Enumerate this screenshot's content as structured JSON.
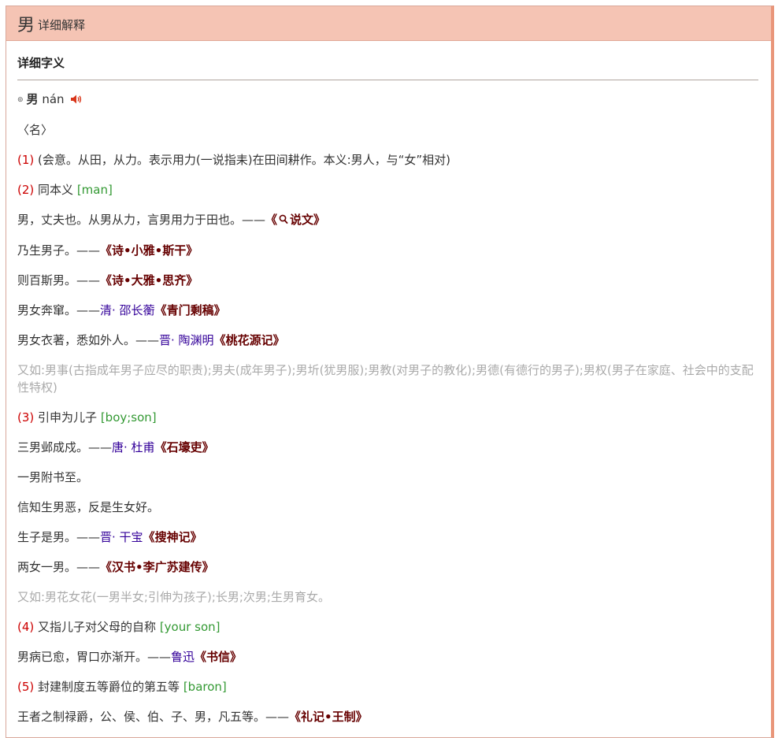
{
  "header": {
    "char": "男",
    "subtitle": "详细解释"
  },
  "section": {
    "title": "详细字义"
  },
  "pronunciation": {
    "char": "男",
    "pinyin": "nán"
  },
  "pos": "〈名〉",
  "entries": [
    {
      "type": "def",
      "num": "(1)",
      "text": "(会意。从田，从力。表示用力(一说指耒)在田间耕作。本义:男人，与“女”相对)",
      "en": ""
    },
    {
      "type": "def",
      "num": "(2)",
      "text": "同本义",
      "en": "[man]"
    },
    {
      "type": "ex",
      "text": "男，丈夫也。从男从力，言男用力于田也。——",
      "author": "",
      "source_open": "《",
      "source": "说文",
      "source_close": "》",
      "search_icon": true
    },
    {
      "type": "ex",
      "text": "乃生男子。——",
      "author": "",
      "source": "《诗•小雅•斯干》"
    },
    {
      "type": "ex",
      "text": "则百斯男。——",
      "author": "",
      "source": "《诗•大雅•思齐》"
    },
    {
      "type": "ex",
      "text": "男女奔窜。——",
      "author": "清· 邵长蘅",
      "source": "《青门剩稿》"
    },
    {
      "type": "ex",
      "text": "男女衣著，悉如外人。——",
      "author": "晋· 陶渊明",
      "source": "《桃花源记》"
    },
    {
      "type": "note",
      "text": "又如:男事(古指成年男子应尽的职责);男夫(成年男子);男圻(犹男服);男教(对男子的教化);男德(有德行的男子);男权(男子在家庭、社会中的支配性特权)"
    },
    {
      "type": "def",
      "num": "(3)",
      "text": "引申为儿子",
      "en": "[boy;son]"
    },
    {
      "type": "ex",
      "text": "三男邺成戍。——",
      "author": "唐· 杜甫",
      "source": "《石壕吏》"
    },
    {
      "type": "ex",
      "text": "一男附书至。",
      "author": "",
      "source": ""
    },
    {
      "type": "ex",
      "text": "信知生男恶，反是生女好。",
      "author": "",
      "source": ""
    },
    {
      "type": "ex",
      "text": "生子是男。——",
      "author": "晋· 干宝",
      "source": "《搜神记》"
    },
    {
      "type": "ex",
      "text": "两女一男。——",
      "author": "",
      "source": "《汉书•李广苏建传》"
    },
    {
      "type": "note",
      "text": "又如:男花女花(一男半女;引伸为孩子);长男;次男;生男育女。"
    },
    {
      "type": "def",
      "num": "(4)",
      "text": "又指儿子对父母的自称",
      "en": "[your son]"
    },
    {
      "type": "ex",
      "text": "男病已愈，胃口亦渐开。——",
      "author": "鲁迅",
      "source": "《书信》"
    },
    {
      "type": "def",
      "num": "(5)",
      "text": "封建制度五等爵位的第五等",
      "en": "[baron]"
    },
    {
      "type": "ex",
      "text": "王者之制禄爵，公、侯、伯、子、男，凡五等。——",
      "author": "",
      "source": "《礼记•王制》"
    }
  ]
}
